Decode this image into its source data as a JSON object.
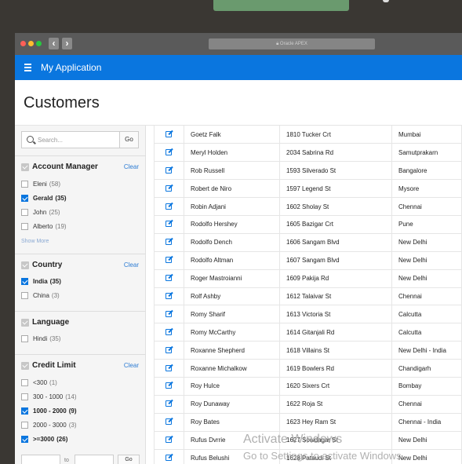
{
  "browser": {
    "url": "Oracle APEX"
  },
  "app": {
    "title": "My Application"
  },
  "page": {
    "title": "Customers"
  },
  "search": {
    "placeholder": "Search...",
    "go_label": "Go"
  },
  "facets": {
    "account_manager": {
      "title": "Account Manager",
      "clear": "Clear",
      "show_more": "Show More",
      "options": [
        {
          "label": "Eleni",
          "count": "(58)",
          "checked": false
        },
        {
          "label": "Gerald",
          "count": "(35)",
          "checked": true
        },
        {
          "label": "John",
          "count": "(25)",
          "checked": false
        },
        {
          "label": "Alberto",
          "count": "(19)",
          "checked": false
        }
      ]
    },
    "country": {
      "title": "Country",
      "clear": "Clear",
      "options": [
        {
          "label": "India",
          "count": "(35)",
          "checked": true
        },
        {
          "label": "China",
          "count": "(3)",
          "checked": false
        }
      ]
    },
    "language": {
      "title": "Language",
      "options": [
        {
          "label": "Hindi",
          "count": "(35)",
          "checked": false
        }
      ]
    },
    "credit_limit": {
      "title": "Credit Limit",
      "clear": "Clear",
      "options": [
        {
          "label": "<300",
          "count": "(1)",
          "checked": false
        },
        {
          "label": "300 - 1000",
          "count": "(14)",
          "checked": false
        },
        {
          "label": "1000 - 2000",
          "count": "(9)",
          "checked": true
        },
        {
          "label": "2000 - 3000",
          "count": "(3)",
          "checked": false
        },
        {
          "label": ">=3000",
          "count": "(26)",
          "checked": true
        }
      ],
      "range_to": "to",
      "range_go": "Go"
    }
  },
  "rows": [
    [
      "Goetz Falk",
      "1810 Tucker Crt",
      "Mumbai"
    ],
    [
      "Meryl Holden",
      "2034 Sabrina Rd",
      "Samutprakarn"
    ],
    [
      "Rob Russell",
      "1593 Silverado St",
      "Bangalore"
    ],
    [
      "Robert de Niro",
      "1597 Legend St",
      "Mysore"
    ],
    [
      "Robin Adjani",
      "1602 Sholay St",
      "Chennai"
    ],
    [
      "Rodolfo Hershey",
      "1605 Bazigar Crt",
      "Pune"
    ],
    [
      "Rodolfo Dench",
      "1606 Sangam Blvd",
      "New Delhi"
    ],
    [
      "Rodolfo Altman",
      "1607 Sangam Blvd",
      "New Delhi"
    ],
    [
      "Roger Mastroianni",
      "1609 Pakija Rd",
      "New Delhi"
    ],
    [
      "Rolf Ashby",
      "1612 Talaivar St",
      "Chennai"
    ],
    [
      "Romy Sharif",
      "1613 Victoria St",
      "Calcutta"
    ],
    [
      "Romy McCarthy",
      "1614 Gitanjali Rd",
      "Calcutta"
    ],
    [
      "Roxanne Shepherd",
      "1618 Villains St",
      "New Delhi - India"
    ],
    [
      "Roxanne Michalkow",
      "1619 Bowlers Rd",
      "Chandigarh"
    ],
    [
      "Roy Hulce",
      "1620 Sixers Crt",
      "Bombay"
    ],
    [
      "Roy Dunaway",
      "1622 Roja St",
      "Chennai"
    ],
    [
      "Roy Bates",
      "1623 Hey Ram St",
      "Chennai - India"
    ],
    [
      "Rufus Dvrrie",
      "1627 Sowdagar St",
      "New Delhi"
    ],
    [
      "Rufus Belushi",
      "1628 Pataudi St",
      "New Delhi"
    ]
  ],
  "watermark": {
    "line1": "Activate Windows",
    "line2": "Go to Settings to activate Windows."
  }
}
